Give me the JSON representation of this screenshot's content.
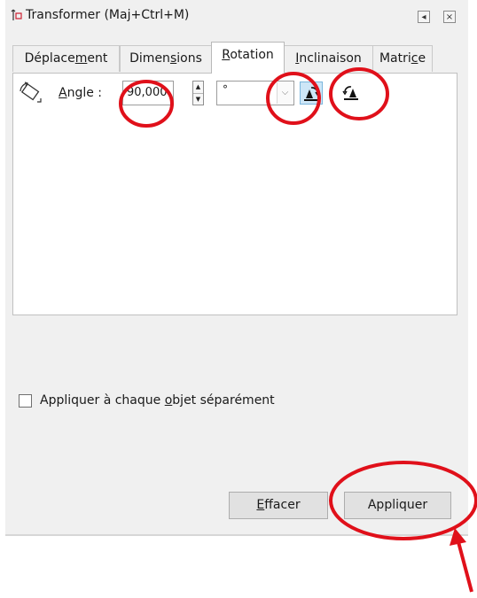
{
  "window": {
    "title": "Transformer (Maj+Ctrl+M)"
  },
  "tabs": [
    {
      "pre": "Déplace",
      "ul": "m",
      "post": "ent",
      "active": false
    },
    {
      "pre": "Dimen",
      "ul": "s",
      "post": "ions",
      "active": false
    },
    {
      "pre": "",
      "ul": "R",
      "post": "otation",
      "active": true
    },
    {
      "pre": "",
      "ul": "I",
      "post": "nclinaison",
      "active": false
    },
    {
      "pre": "Matri",
      "ul": "c",
      "post": "e",
      "active": false
    }
  ],
  "rotation": {
    "angle_label_pre": "",
    "angle_label_ul": "A",
    "angle_label_post": "ngle :",
    "angle_value": "90,000",
    "unit_value": "°"
  },
  "checkbox": {
    "label_pre": "Appliquer à chaque ",
    "label_ul": "o",
    "label_post": "bjet séparément",
    "checked": false
  },
  "buttons": {
    "clear_ul": "E",
    "clear_post": "ffacer",
    "apply_label": "Appliquer"
  },
  "annotations": {
    "color": "#e0101a"
  },
  "icons": [
    "transform-title-icon",
    "collapse-icon",
    "close-icon",
    "rotate-object-icon",
    "rotate-ccw-icon",
    "rotate-cw-icon"
  ]
}
